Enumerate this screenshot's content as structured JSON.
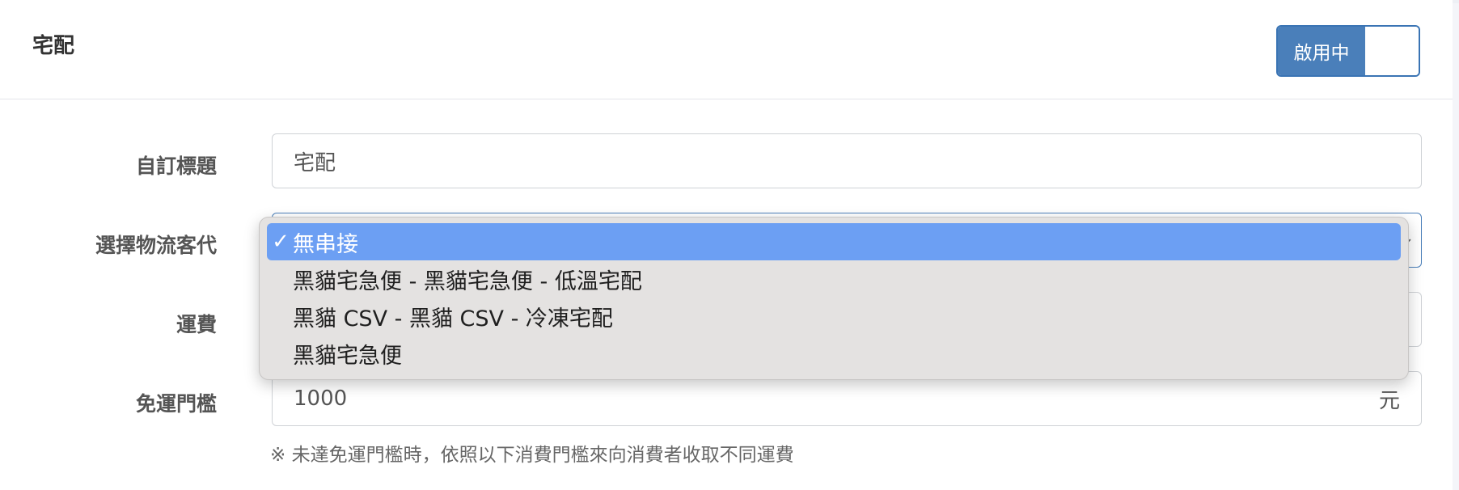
{
  "section": {
    "title": "宅配",
    "toggle_label": "啟用中"
  },
  "form": {
    "custom_title": {
      "label": "自訂標題",
      "value": "宅配"
    },
    "logistics": {
      "label": "選擇物流客代",
      "selected": "無串接",
      "options": [
        {
          "label": "無串接",
          "selected": true
        },
        {
          "label": "黑貓宅急便 - 黑貓宅急便 - 低溫宅配",
          "selected": false
        },
        {
          "label": "黑貓 CSV - 黑貓 CSV - 冷凍宅配",
          "selected": false
        },
        {
          "label": "黑貓宅急便",
          "selected": false
        }
      ]
    },
    "shipping_fee": {
      "label": "運費"
    },
    "free_threshold": {
      "label": "免運門檻",
      "value": "1000",
      "unit": "元"
    },
    "hint": "※ 未達免運門檻時，依照以下消費門檻來向消費者收取不同運費"
  },
  "icons": {
    "check": "checkmark-icon",
    "chevron": "chevron-down-icon"
  },
  "colors": {
    "accent": "#4a7fba",
    "selected_option": "#6c9ff3",
    "dropdown_bg": "#e4e2e1"
  }
}
